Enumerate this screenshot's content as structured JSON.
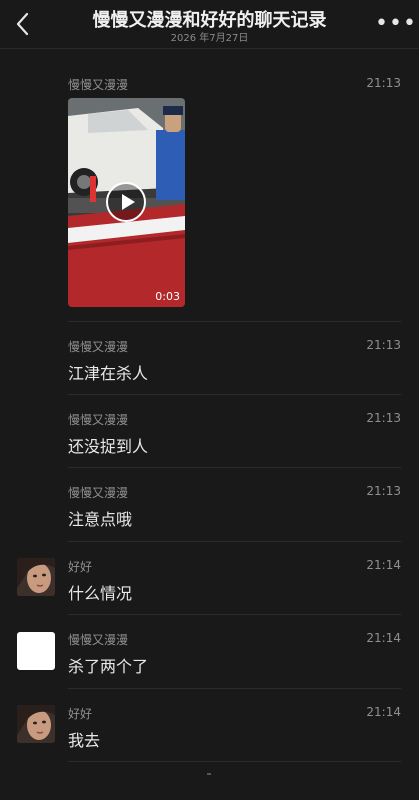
{
  "header": {
    "title": "慢慢又漫漫和好好的聊天记录",
    "subtitle": "2026 年7月27日",
    "back_icon": "chevron-left-icon",
    "more_icon": "more-horizontal-icon"
  },
  "messages": [
    {
      "sender": "慢慢又漫漫",
      "time": "21:13",
      "type": "video",
      "duration": "0:03"
    },
    {
      "sender": "慢慢又漫漫",
      "time": "21:13",
      "text": "江津在杀人"
    },
    {
      "sender": "慢慢又漫漫",
      "time": "21:13",
      "text": "还没捉到人"
    },
    {
      "sender": "慢慢又漫漫",
      "time": "21:13",
      "text": "注意点哦"
    },
    {
      "sender": "好好",
      "time": "21:14",
      "text": "什么情况",
      "avatar": "photo"
    },
    {
      "sender": "慢慢又漫漫",
      "time": "21:14",
      "text": "杀了两个了",
      "avatar": "white"
    },
    {
      "sender": "好好",
      "time": "21:14",
      "text": "我去",
      "avatar": "photo"
    }
  ]
}
